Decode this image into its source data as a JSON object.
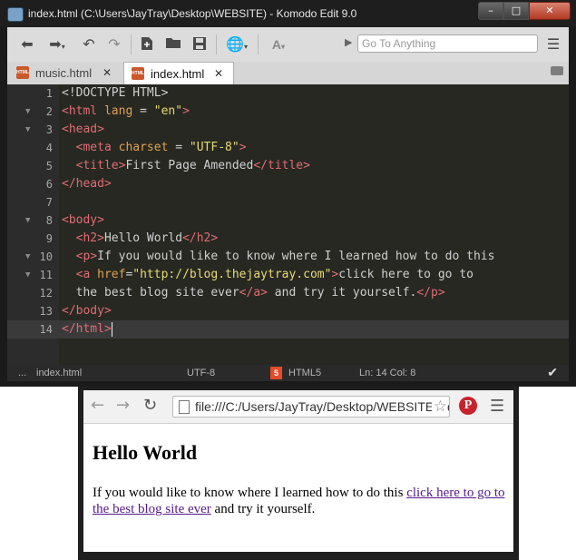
{
  "komodo": {
    "title": "index.html (C:\\Users\\JayTray\\Desktop\\WEBSITE) - Komodo Edit 9.0",
    "window_buttons": {
      "minimize": "–",
      "maximize": "□",
      "close": "✕"
    },
    "toolbar": {
      "goto_placeholder": "Go To Anything",
      "icons": [
        "back-arrow-icon",
        "forward-arrow-icon",
        "undo-icon",
        "redo-icon",
        "new-file-icon",
        "open-folder-icon",
        "save-icon",
        "globe-icon",
        "font-icon",
        "menu-icon"
      ]
    },
    "tabs": [
      {
        "label": "music.html",
        "icon": "html",
        "active": false
      },
      {
        "label": "index.html",
        "icon": "html",
        "active": true
      }
    ],
    "code_lines": [
      {
        "n": "1",
        "fold": false,
        "tokens": [
          {
            "c": "p",
            "t": "<!DOCTYPE HTML>"
          }
        ]
      },
      {
        "n": "2",
        "fold": true,
        "tokens": [
          {
            "c": "t",
            "t": "<html "
          },
          {
            "c": "a",
            "t": "lang"
          },
          {
            "c": "p",
            "t": " = "
          },
          {
            "c": "s",
            "t": "\"en\""
          },
          {
            "c": "t",
            "t": ">"
          }
        ]
      },
      {
        "n": "3",
        "fold": true,
        "tokens": [
          {
            "c": "t",
            "t": "<head>"
          }
        ]
      },
      {
        "n": "4",
        "fold": false,
        "tokens": [
          {
            "c": "p",
            "t": "  "
          },
          {
            "c": "t",
            "t": "<meta "
          },
          {
            "c": "a",
            "t": "charset"
          },
          {
            "c": "p",
            "t": " = "
          },
          {
            "c": "s",
            "t": "\"UTF-8\""
          },
          {
            "c": "t",
            "t": ">"
          }
        ]
      },
      {
        "n": "5",
        "fold": false,
        "tokens": [
          {
            "c": "p",
            "t": "  "
          },
          {
            "c": "t",
            "t": "<title>"
          },
          {
            "c": "p",
            "t": "First Page Amended"
          },
          {
            "c": "t",
            "t": "</title>"
          }
        ]
      },
      {
        "n": "6",
        "fold": false,
        "tokens": [
          {
            "c": "t",
            "t": "</head>"
          }
        ]
      },
      {
        "n": "7",
        "fold": false,
        "tokens": []
      },
      {
        "n": "8",
        "fold": true,
        "tokens": [
          {
            "c": "t",
            "t": "<body>"
          }
        ]
      },
      {
        "n": "9",
        "fold": false,
        "tokens": [
          {
            "c": "p",
            "t": "  "
          },
          {
            "c": "t",
            "t": "<h2>"
          },
          {
            "c": "p",
            "t": "Hello World"
          },
          {
            "c": "t",
            "t": "</h2>"
          }
        ]
      },
      {
        "n": "10",
        "fold": true,
        "tokens": [
          {
            "c": "p",
            "t": "  "
          },
          {
            "c": "t",
            "t": "<p>"
          },
          {
            "c": "p",
            "t": "If you would like to know where I learned how to do this"
          }
        ]
      },
      {
        "n": "11",
        "fold": true,
        "tokens": [
          {
            "c": "p",
            "t": "  "
          },
          {
            "c": "t",
            "t": "<a "
          },
          {
            "c": "a",
            "t": "href"
          },
          {
            "c": "p",
            "t": "="
          },
          {
            "c": "s",
            "t": "\"http://blog.thejaytray.com\""
          },
          {
            "c": "t",
            "t": ">"
          },
          {
            "c": "p",
            "t": "click here to go to"
          }
        ]
      },
      {
        "n": "12",
        "fold": false,
        "tokens": [
          {
            "c": "p",
            "t": "  the best blog site ever"
          },
          {
            "c": "t",
            "t": "</a>"
          },
          {
            "c": "p",
            "t": " and try it yourself."
          },
          {
            "c": "t",
            "t": "</p>"
          }
        ]
      },
      {
        "n": "13",
        "fold": false,
        "tokens": [
          {
            "c": "t",
            "t": "</body>"
          }
        ]
      },
      {
        "n": "14",
        "fold": false,
        "current": true,
        "tokens": [
          {
            "c": "t",
            "t": "</html>"
          }
        ]
      }
    ],
    "status": {
      "dots": "...",
      "filename": "index.html",
      "encoding": "UTF-8",
      "language": "HTML5",
      "position": "Ln: 14 Col: 8",
      "check_icon": "checkmark-icon"
    },
    "colors": {
      "tag": "#e06c75",
      "attr": "#e0a050",
      "string": "#e6db74",
      "background": "#272822"
    }
  },
  "browser": {
    "url": "file:///C:/Users/JayTray/Desktop/WEBSITE/index.html",
    "page": {
      "heading": "Hello World",
      "text_before": "If you would like to know where I learned how to do this ",
      "link_text": "click here to go to the best blog site ever",
      "text_after": " and try it yourself."
    }
  }
}
